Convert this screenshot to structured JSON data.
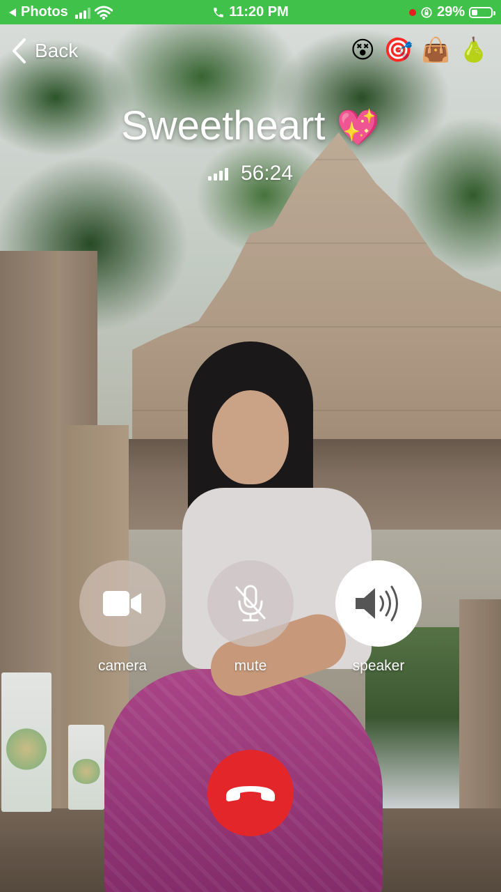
{
  "status_bar": {
    "back_app": "Photos",
    "time": "11:20 PM",
    "battery": "29%",
    "battery_level": 0.29,
    "cellular_bars": 3
  },
  "nav": {
    "back_label": "Back",
    "emojis": [
      "😵",
      "🎯",
      "👜",
      "🍐"
    ]
  },
  "call": {
    "name": "Sweetheart",
    "name_emoji": "💖",
    "duration": "56:24"
  },
  "controls": {
    "camera_label": "camera",
    "mute_label": "mute",
    "speaker_label": "speaker"
  },
  "colors": {
    "status_bar_bg": "#3fc14a",
    "end_call": "#e3262a"
  },
  "icons": {
    "camera": "video-camera-icon",
    "mute": "microphone-slash-icon",
    "speaker": "speaker-wave-icon",
    "end_call": "phone-hangup-icon"
  }
}
